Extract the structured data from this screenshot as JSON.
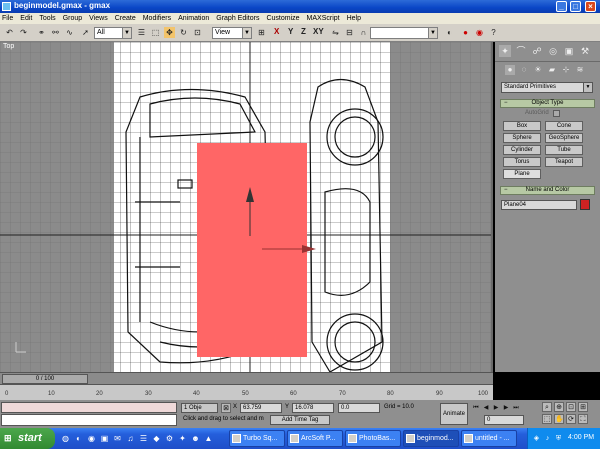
{
  "window": {
    "title": "beginmodel.gmax - gmax"
  },
  "menubar": [
    "File",
    "Edit",
    "Tools",
    "Group",
    "Views",
    "Create",
    "Modifiers",
    "Animation",
    "Graph Editors",
    "Customize",
    "MAXScript",
    "Help"
  ],
  "toolbar": {
    "selection_filter": "All",
    "reference_coord": "View",
    "axis_x": "X",
    "axis_y": "Y",
    "axis_z": "Z",
    "axis_xy": "XY"
  },
  "viewport": {
    "label": "Top",
    "plane_color": "#ff6666",
    "grid_bg": "#ffffff"
  },
  "command_panel": {
    "category": "Standard Primitives",
    "object_type": {
      "header": "Object Type",
      "autogrid": "AutoGrid",
      "buttons": [
        "Box",
        "Cone",
        "Sphere",
        "GeoSphere",
        "Cylinder",
        "Tube",
        "Torus",
        "Teapot",
        "Plane"
      ]
    },
    "name_and_color": {
      "header": "Name and Color",
      "name": "Plane04",
      "color": "#cc2222"
    }
  },
  "timeline": {
    "frame": "0 / 100",
    "ticks": [
      "0",
      "10",
      "20",
      "30",
      "40",
      "50",
      "60",
      "70",
      "80",
      "90",
      "100"
    ]
  },
  "status": {
    "selection": "1 Obje",
    "x_label": "X",
    "x_value": "63.759",
    "y_label": "Y",
    "y_value": "16.078",
    "z_value": "0.0",
    "grid": "Grid = 10.0",
    "message": "Click and drag to select and m",
    "add_time_tag": "Add Time Tag",
    "animate": "Animate",
    "frame_field": "0"
  },
  "taskbar": {
    "start": "start",
    "tasks": [
      "Turbo Sq...",
      "ArcSoft P...",
      "PhotoBas...",
      "beginmod...",
      "untitled - ..."
    ],
    "clock": "4:00 PM"
  }
}
